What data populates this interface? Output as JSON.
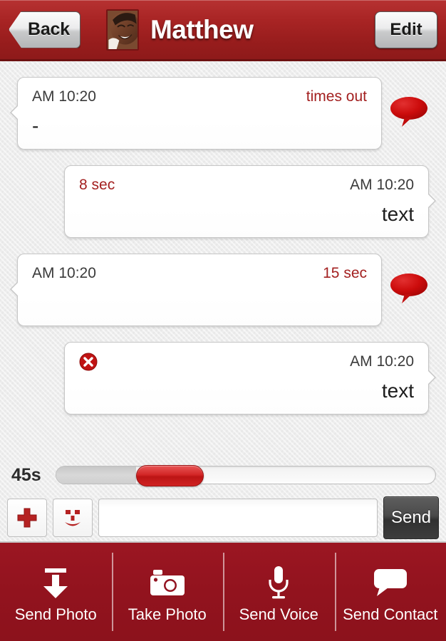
{
  "header": {
    "back_label": "Back",
    "title": "Matthew",
    "edit_label": "Edit",
    "avatar_name": "contact-avatar-photo",
    "background_color": "#a82424"
  },
  "conversation": {
    "messages": [
      {
        "direction": "incoming",
        "meta_left": "AM 10:20",
        "meta_right": "times out",
        "meta_right_color": "#a32020",
        "body": "-",
        "status_icon": "speech-bubble-icon",
        "error": false
      },
      {
        "direction": "outgoing",
        "meta_left": "8 sec",
        "meta_left_color": "#a32020",
        "meta_right": "AM 10:20",
        "body": "text",
        "status_icon": "",
        "error": false
      },
      {
        "direction": "incoming",
        "meta_left": "AM 10:20",
        "meta_right": "15 sec",
        "meta_right_color": "#a32020",
        "body": "",
        "status_icon": "speech-bubble-icon",
        "error": false
      },
      {
        "direction": "outgoing",
        "meta_left": "",
        "meta_right": "AM 10:20",
        "body": "text",
        "status_icon": "",
        "error": true,
        "error_icon": "error-circle-x-icon"
      }
    ]
  },
  "slider": {
    "label": "45s",
    "fill_percent": 21,
    "thumb_percent": 21,
    "thumb_color": "#cf2222"
  },
  "input_bar": {
    "add_icon": "plus-icon",
    "emoji_icon": "smiley-icon",
    "message_value": "",
    "message_placeholder": "",
    "send_label": "Send"
  },
  "toolbar": {
    "items": [
      {
        "icon": "download-arrow-icon",
        "label": "Send Photo"
      },
      {
        "icon": "camera-icon",
        "label": "Take Photo"
      },
      {
        "icon": "microphone-icon",
        "label": "Send Voice"
      },
      {
        "icon": "chat-bubble-icon",
        "label": "Send Contact"
      }
    ]
  }
}
